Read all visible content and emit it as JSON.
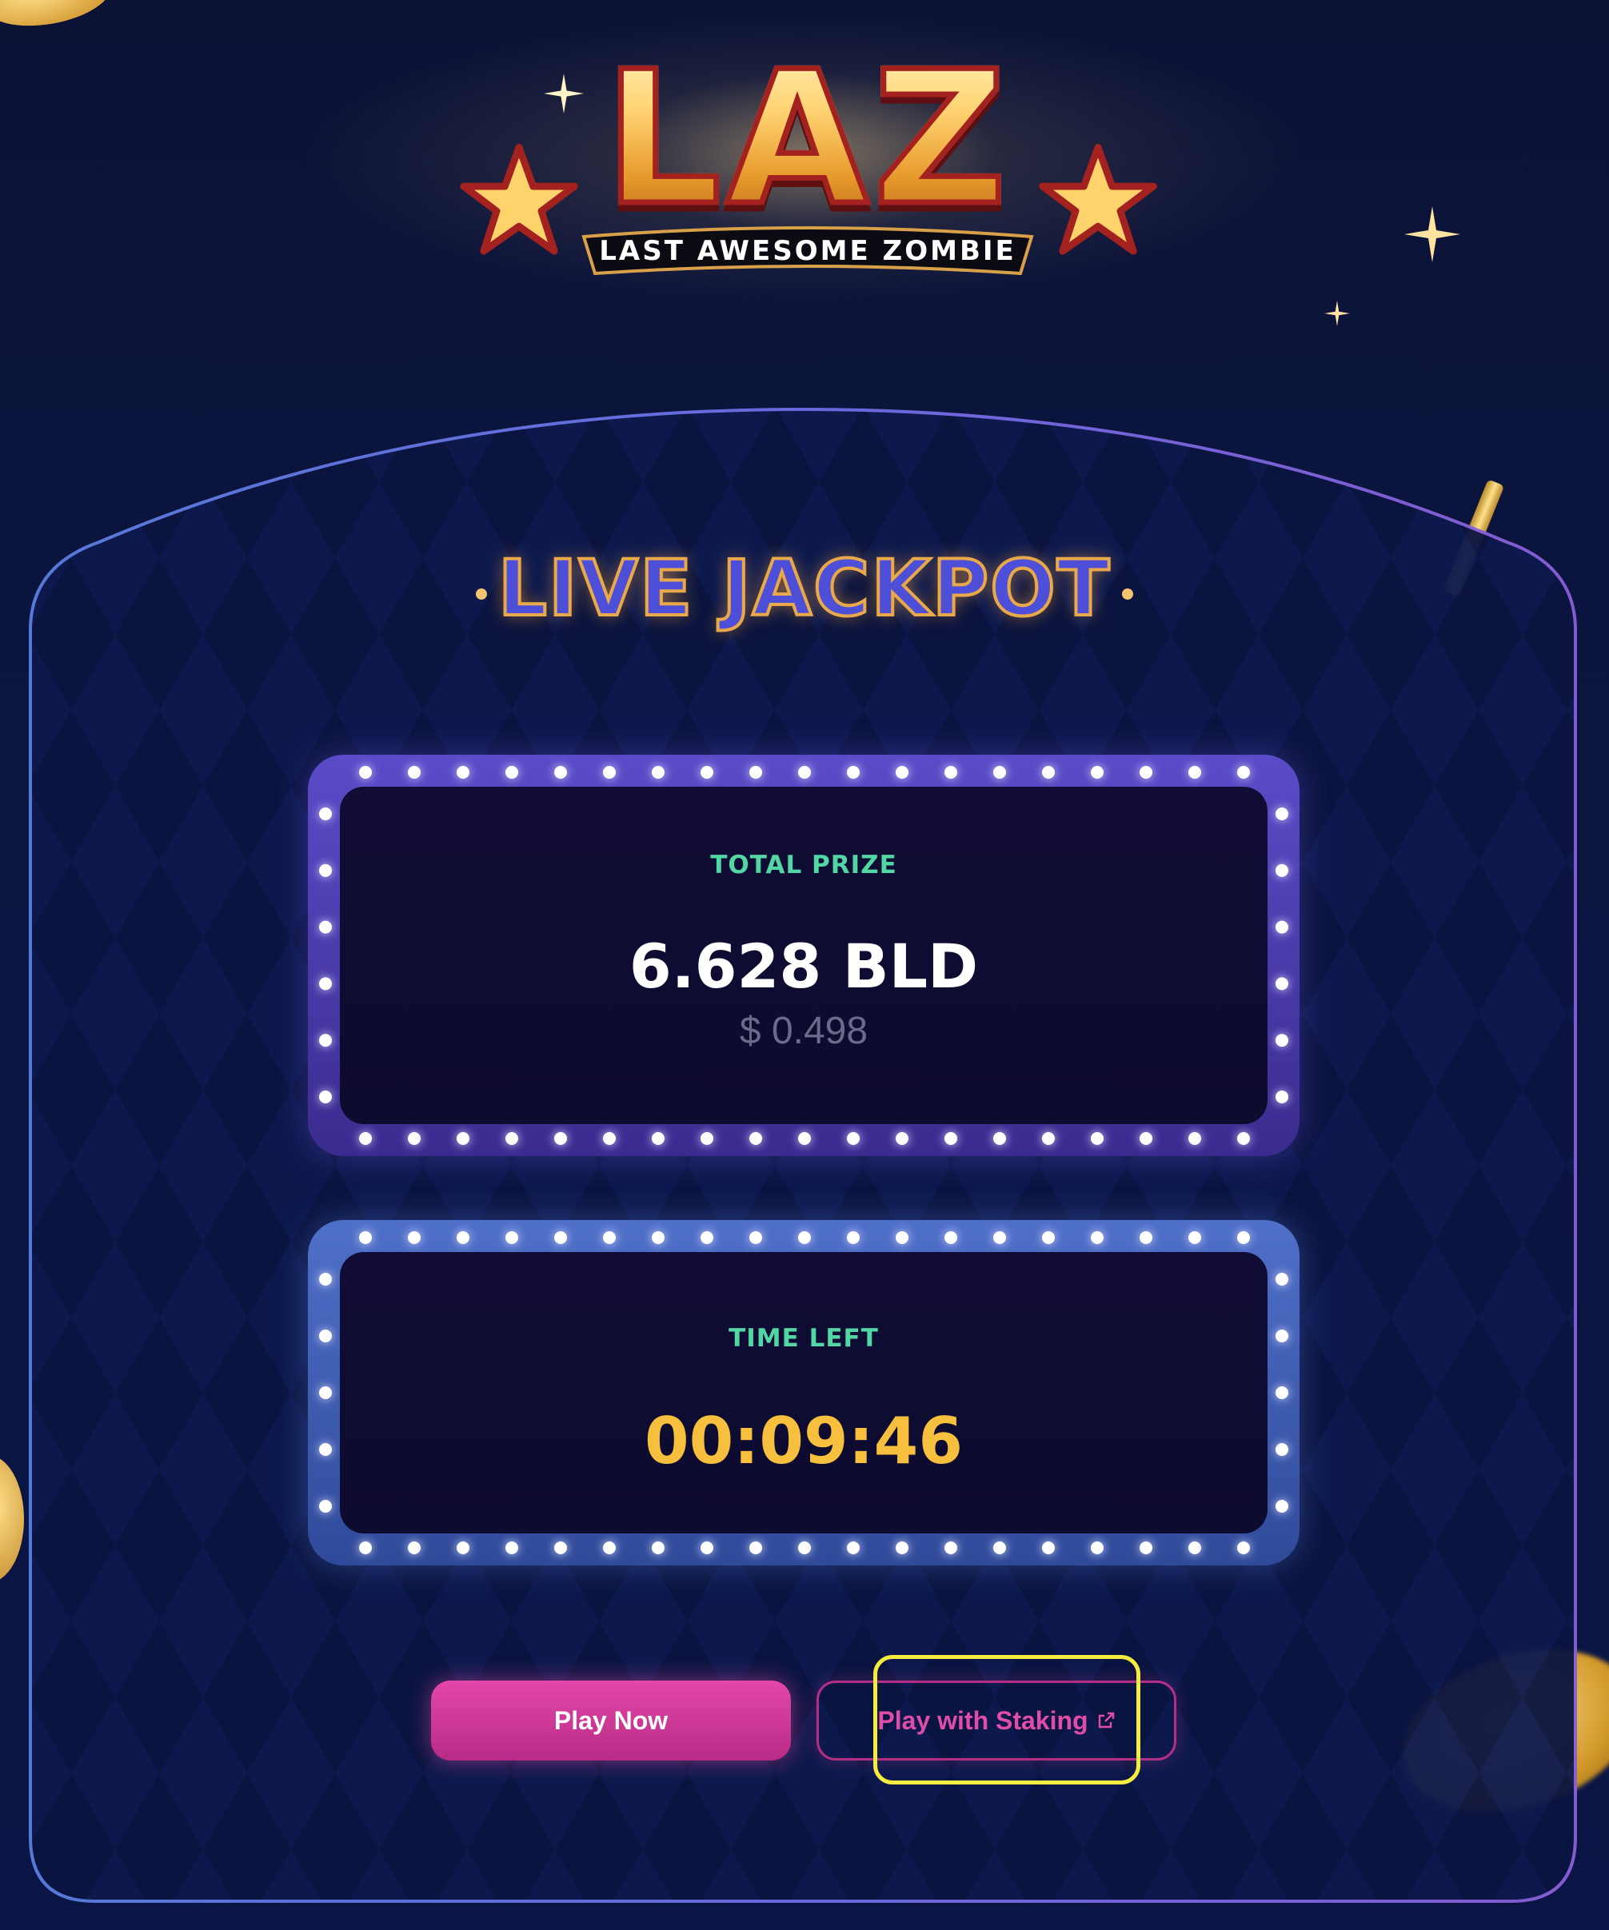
{
  "logo": {
    "wordmark": "LAZ",
    "tagline": "LAST AWESOME ZOMBIE"
  },
  "jackpot": {
    "title": "LIVE JACKPOT",
    "prize": {
      "label": "TOTAL PRIZE",
      "amount": "6.628 BLD",
      "usd": "$ 0.498"
    },
    "timer": {
      "label": "TIME LEFT",
      "value": "00:09:46"
    }
  },
  "actions": {
    "play_now": "Play Now",
    "play_with_staking": "Play with Staking"
  },
  "colors": {
    "background": "#0a1033",
    "prize_frame": "#5a4cc8",
    "timer_frame": "#4f70c9",
    "label_green": "#52d6a4",
    "timer_gold": "#f6c03e",
    "button_pink": "#e347a8",
    "highlight": "#f4ec3f"
  },
  "icons": {
    "logo_stars": "star-icon",
    "staking_link": "external-link-icon"
  }
}
